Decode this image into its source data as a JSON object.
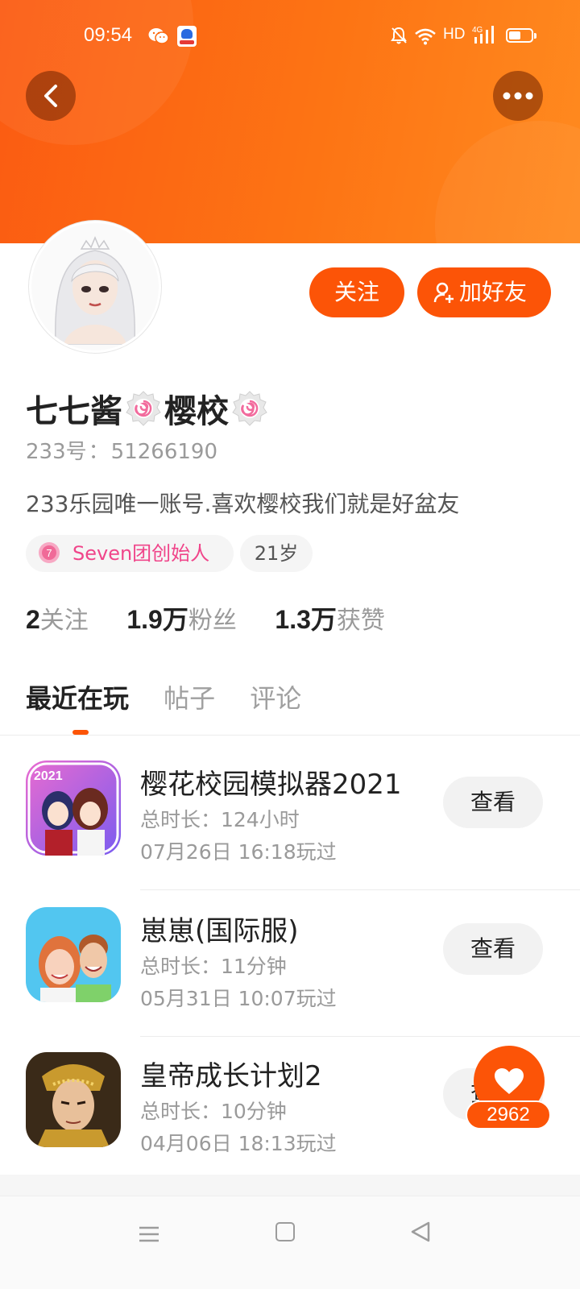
{
  "status_bar": {
    "time": "09:54",
    "network": "HD",
    "icons": [
      "wechat-icon",
      "baidu-icon",
      "mute-icon",
      "wifi-icon",
      "signal-4g-icon",
      "battery-icon"
    ]
  },
  "header": {
    "back_icon": "chevron-left-icon",
    "more_icon": "more-dots-icon",
    "accent_color": "#fc5407"
  },
  "profile": {
    "follow_label": "关注",
    "add_friend_label": "加好友",
    "name_part1": "七七酱",
    "name_part2": "樱校",
    "id_label": "233号",
    "id_sep": "：",
    "id_value": "51266190",
    "bio": "233乐园唯一账号.喜欢樱校我们就是好盆友",
    "tags": {
      "founder": "Seven团创始人",
      "age": "21岁"
    },
    "stats": [
      {
        "num": "2",
        "label": "关注"
      },
      {
        "num": "1.9万",
        "label": "粉丝"
      },
      {
        "num": "1.3万",
        "label": "获赞"
      }
    ]
  },
  "tabs": [
    "最近在玩",
    "帖子",
    "评论"
  ],
  "active_tab": "最近在玩",
  "games": [
    {
      "title": "樱花校园模拟器2021",
      "duration": "总时长：124小时",
      "last_played": "07月26日 16:18玩过",
      "button": "查看"
    },
    {
      "title": "崽崽(国际服)",
      "duration": "总时长：11分钟",
      "last_played": "05月31日 10:07玩过",
      "button": "查看"
    },
    {
      "title": "皇帝成长计划2",
      "duration": "总时长：10分钟",
      "last_played": "04月06日 18:13玩过",
      "button": "查看"
    }
  ],
  "like": {
    "count": "2962",
    "icon": "heart-icon"
  },
  "nav": {
    "icons": [
      "menu-icon",
      "home-square-icon",
      "back-triangle-icon"
    ]
  }
}
